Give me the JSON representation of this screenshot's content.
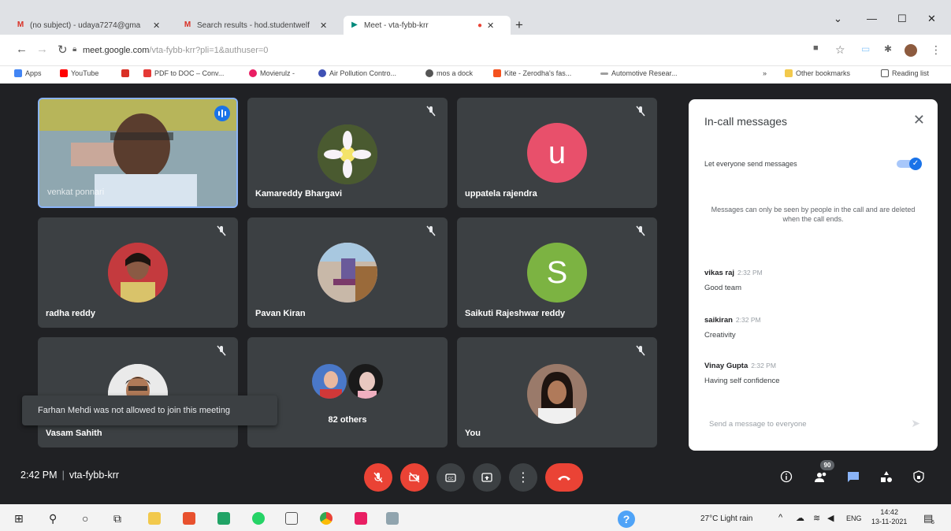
{
  "browser": {
    "tabs": [
      {
        "title": "(no subject) - udaya7274@gma",
        "icon": "gmail-icon",
        "color": "#d93025"
      },
      {
        "title": "Search results - hod.studentwelf",
        "icon": "gmail-icon",
        "color": "#d93025"
      },
      {
        "title": "Meet - vta-fybb-krr",
        "icon": "meet-icon",
        "color": "#00897b"
      }
    ],
    "new_tab": "+",
    "url_host": "meet.google.com",
    "url_path": "/vta-fybb-krr?pli=1&authuser=0",
    "bookmarks": [
      {
        "label": "Apps",
        "color": "#4285f4"
      },
      {
        "label": "YouTube",
        "color": "#ff0000"
      },
      {
        "label": "",
        "color": "#d93025"
      },
      {
        "label": "PDF to DOC – Conv...",
        "color": "#e53935"
      },
      {
        "label": "Movierulz -",
        "color": "#e91e63"
      },
      {
        "label": "Air Pollution Contro...",
        "color": "#3f51b5"
      },
      {
        "label": "mos a dock",
        "color": "#555555"
      },
      {
        "label": "Kite - Zerodha's fas...",
        "color": "#f4511e"
      },
      {
        "label": "Automotive Resear...",
        "color": "#9e9e9e"
      }
    ],
    "other_bookmarks": "Other bookmarks",
    "reading_list": "Reading list"
  },
  "tiles": [
    {
      "name": "venkat ponnari",
      "kind": "video",
      "speaking": true
    },
    {
      "name": "Kamareddy Bhargavi",
      "kind": "photo",
      "color": "#5b6b3a"
    },
    {
      "name": "uppatela rajendra",
      "kind": "letter",
      "letter": "u",
      "color": "#e8506b"
    },
    {
      "name": "radha reddy",
      "kind": "photo",
      "color": "#b0303a"
    },
    {
      "name": "Pavan Kiran",
      "kind": "photo",
      "color": "#8a7aa8"
    },
    {
      "name": "Saikuti Rajeshwar reddy",
      "kind": "letter",
      "letter": "S",
      "color": "#7cb342"
    },
    {
      "name": "Vasam Sahith",
      "kind": "photo",
      "color": "#d8d8d8"
    },
    {
      "name": "82 others",
      "kind": "others"
    },
    {
      "name": "You",
      "kind": "photo",
      "color": "#6a4a3a"
    }
  ],
  "toast": "Farhan Mehdi was not allowed to join this meeting",
  "chat": {
    "title": "In-call messages",
    "let_everyone": "Let everyone send messages",
    "notice": "Messages can only be seen by people in the call and are deleted when the call ends.",
    "messages": [
      {
        "sender": "vikas raj",
        "time": "2:32 PM",
        "text": "Good team"
      },
      {
        "sender": "saikiran",
        "time": "2:32 PM",
        "text": "Creativity"
      },
      {
        "sender": "Vinay Gupta",
        "time": "2:32 PM",
        "text": "Having self confidence"
      }
    ],
    "input_placeholder": "Send a message to everyone"
  },
  "bottom": {
    "time": "2:42 PM",
    "meeting_code": "vta-fybb-krr",
    "people_count": "90"
  },
  "taskbar": {
    "weather": "27°C  Light rain",
    "lang": "ENG",
    "time": "14:42",
    "date": "13-11-2021",
    "notifications": "5"
  },
  "colors": {
    "meet_bg": "#202124",
    "tile_bg": "#3c4043",
    "danger": "#ea4335",
    "accent": "#1a73e8"
  }
}
